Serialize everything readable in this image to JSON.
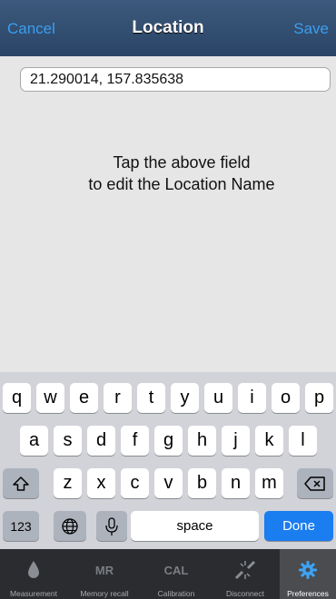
{
  "nav": {
    "cancel": "Cancel",
    "title": "Location",
    "save": "Save"
  },
  "location": {
    "value": "21.290014, 157.835638"
  },
  "hint": {
    "line1": "Tap the above field",
    "line2": "to edit the Location Name"
  },
  "keyboard": {
    "row1": [
      "q",
      "w",
      "e",
      "r",
      "t",
      "y",
      "u",
      "i",
      "o",
      "p"
    ],
    "row2": [
      "a",
      "s",
      "d",
      "f",
      "g",
      "h",
      "j",
      "k",
      "l"
    ],
    "row3": [
      "z",
      "x",
      "c",
      "v",
      "b",
      "n",
      "m"
    ],
    "numbers": "123",
    "space": "space",
    "done": "Done"
  },
  "tabs": [
    {
      "label": "Measurement",
      "icon": "drop-icon"
    },
    {
      "label": "Memory recall",
      "icon_text": "MR"
    },
    {
      "label": "Calibration",
      "icon_text": "CAL"
    },
    {
      "label": "Disconnect",
      "icon": "disconnect-icon"
    },
    {
      "label": "Preferences",
      "icon": "gear-icon"
    }
  ],
  "colors": {
    "accent": "#1a7df0",
    "nav_bg": "#2f4b6e",
    "tab_bg": "#2a2c2f"
  }
}
